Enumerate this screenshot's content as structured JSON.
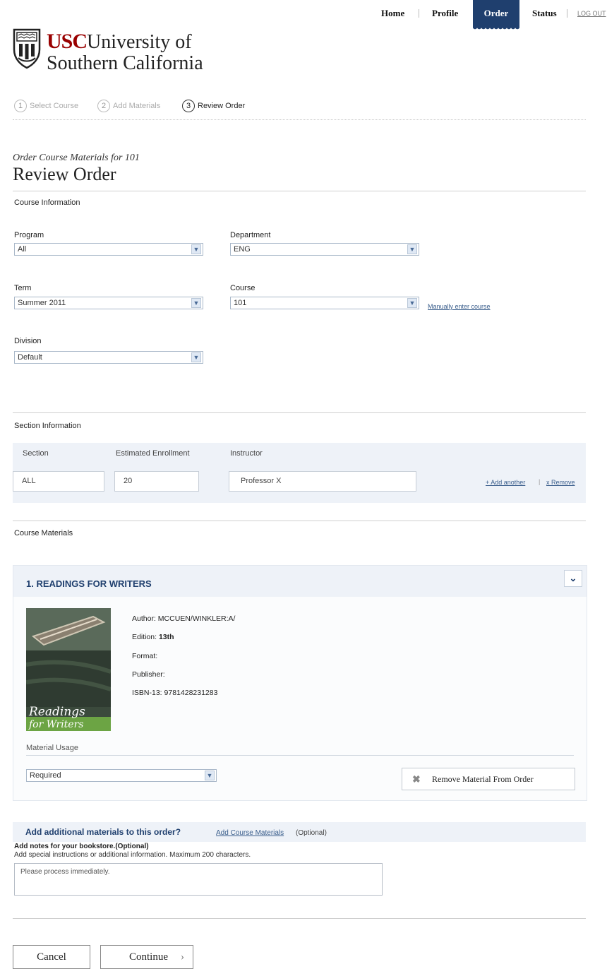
{
  "nav": {
    "home": "Home",
    "profile": "Profile",
    "order": "Order",
    "status": "Status",
    "logout": "LOG OUT"
  },
  "logo": {
    "usc": "USC",
    "line1": "University of",
    "line2": "Southern California"
  },
  "steps": [
    {
      "num": "1",
      "label": "Select Course"
    },
    {
      "num": "2",
      "label": "Add Materials"
    },
    {
      "num": "3",
      "label": "Review Order"
    }
  ],
  "page": {
    "subtitle": "Order Course Materials for 101",
    "title": "Review Order"
  },
  "course_info": {
    "heading": "Course Information",
    "program": {
      "label": "Program",
      "value": "All"
    },
    "department": {
      "label": "Department",
      "value": "ENG"
    },
    "term": {
      "label": "Term",
      "value": "Summer 2011"
    },
    "course": {
      "label": "Course",
      "value": "101"
    },
    "manual_link": "Manually enter course",
    "division": {
      "label": "Division",
      "value": "Default"
    }
  },
  "section_info": {
    "heading": "Section Information",
    "col_section": "Section",
    "col_enrollment": "Estimated Enrollment",
    "col_instructor": "Instructor",
    "section": "ALL",
    "enrollment": "20",
    "instructor": "Professor X",
    "add_another": "+ Add another",
    "remove": "x Remove"
  },
  "materials": {
    "heading": "Course Materials",
    "item_title": "1. READINGS FOR WRITERS",
    "author_label": "Author:",
    "author": "MCCUEN/WINKLER:A/",
    "edition_label": "Edition:",
    "edition": "13th",
    "format_label": "Format:",
    "publisher_label": "Publisher:",
    "isbn_label": "ISBN-13:",
    "isbn": "9781428231283",
    "cover_line1": "Readings",
    "cover_line2": "for Writers",
    "usage_label": "Material Usage",
    "usage_value": "Required",
    "remove_button": "Remove Material From Order"
  },
  "additional": {
    "question": "Add additional materials to this order?",
    "link": "Add Course Materials",
    "optional": "(Optional)"
  },
  "notes": {
    "label": "Add notes for your bookstore.(Optional)",
    "hint": "Add special instructions or additional information. Maximum 200 characters.",
    "value": "Please process immediately."
  },
  "actions": {
    "cancel": "Cancel",
    "continue": "Continue"
  }
}
